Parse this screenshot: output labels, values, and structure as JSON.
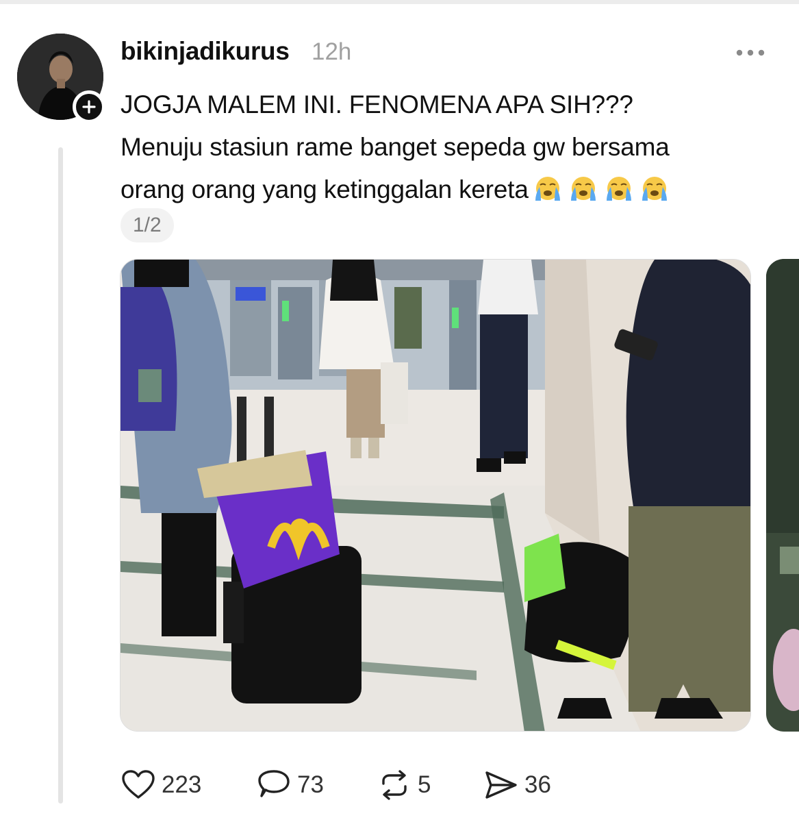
{
  "post": {
    "username": "bikinjadikurus",
    "time": "12h",
    "caption_lines": [
      "JOGJA MALEM INI. FENOMENA APA SIH???",
      "Menuju stasiun rame banget sepeda gw bersama",
      "orang orang yang ketinggalan kereta"
    ],
    "caption_emoji": [
      "loudly-crying-face",
      "loudly-crying-face",
      "loudly-crying-face",
      "loudly-crying-face"
    ],
    "pager": "1/2"
  },
  "media": {
    "current_index": 1,
    "total": 2
  },
  "actions": {
    "likes": "223",
    "replies": "73",
    "reposts": "5",
    "shares": "36"
  },
  "icons": {
    "like": "heart-icon",
    "reply": "speech-bubble-icon",
    "repost": "repost-arrows-icon",
    "share": "paper-plane-icon",
    "more": "more-horizontal-icon",
    "follow": "plus-icon"
  },
  "colors": {
    "text": "#111111",
    "muted": "#a0a0a0",
    "emoji_face": "#f7c948",
    "emoji_tear": "#5aa9f0"
  }
}
